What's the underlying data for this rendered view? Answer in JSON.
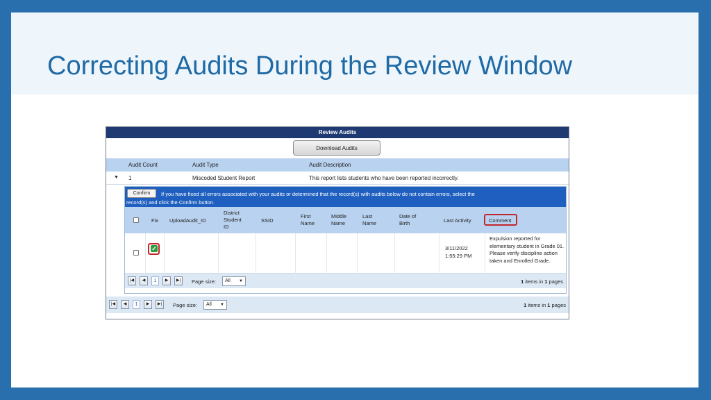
{
  "slide": {
    "title": "Correcting Audits During the Review Window"
  },
  "screen": {
    "header_title": "Review Audits",
    "download_button": "Download Audits",
    "columns": {
      "audit_count": "Audit Count",
      "audit_type": "Audit Type",
      "audit_description": "Audit Description"
    },
    "audit": {
      "count": "1",
      "type": "Miscoded Student Report",
      "description": "This report lists students who have been reported incorrectly."
    },
    "confirm": {
      "button": "Confirm",
      "text_line1": "If you have fixed all errors associated with your audits or determined that the record(s) with audits below do not contain errors, select the",
      "text_line2": "record(s) and click the Confirm button."
    },
    "grid_headers": {
      "fix": "Fix",
      "upload_audit_id": "UploadAudit_ID",
      "district_student_id_1": "District",
      "district_student_id_2": "Student",
      "district_student_id_3": "ID",
      "ssid": "SSID",
      "first_name_1": "First",
      "first_name_2": "Name",
      "middle_name_1": "Middle",
      "middle_name_2": "Name",
      "last_name_1": "Last",
      "last_name_2": "Name",
      "dob_1": "Date of",
      "dob_2": "Birth",
      "last_activity": "Last Activity",
      "comment": "Comment"
    },
    "row": {
      "last_activity_date": "3/11/2022",
      "last_activity_time": "1:55:29 PM",
      "comment": "Expulsion reported for elementary student in Grade 01. Please verify discipline action taken and Enrolled Grade."
    },
    "pager_inner": {
      "first_icon": "first-page-icon",
      "page": "1",
      "page_size_label": "Page size:",
      "page_size_value": "All",
      "info_prefix": "1",
      "info_mid": " items in ",
      "info_pages": "1",
      "info_suffix": " pages"
    },
    "pager_outer": {
      "page": "1",
      "page_size_label": "Page size:",
      "page_size_value": "All",
      "info_prefix": "1",
      "info_mid": " items in ",
      "info_pages": "1",
      "info_suffix": " pages"
    },
    "colors": {
      "header_navy": "#1f3a72",
      "column_blue": "#b9d2ef",
      "confirm_blue": "#1f5fbf",
      "highlight_red": "#c0282d",
      "check_green": "#2e9b3e"
    }
  }
}
